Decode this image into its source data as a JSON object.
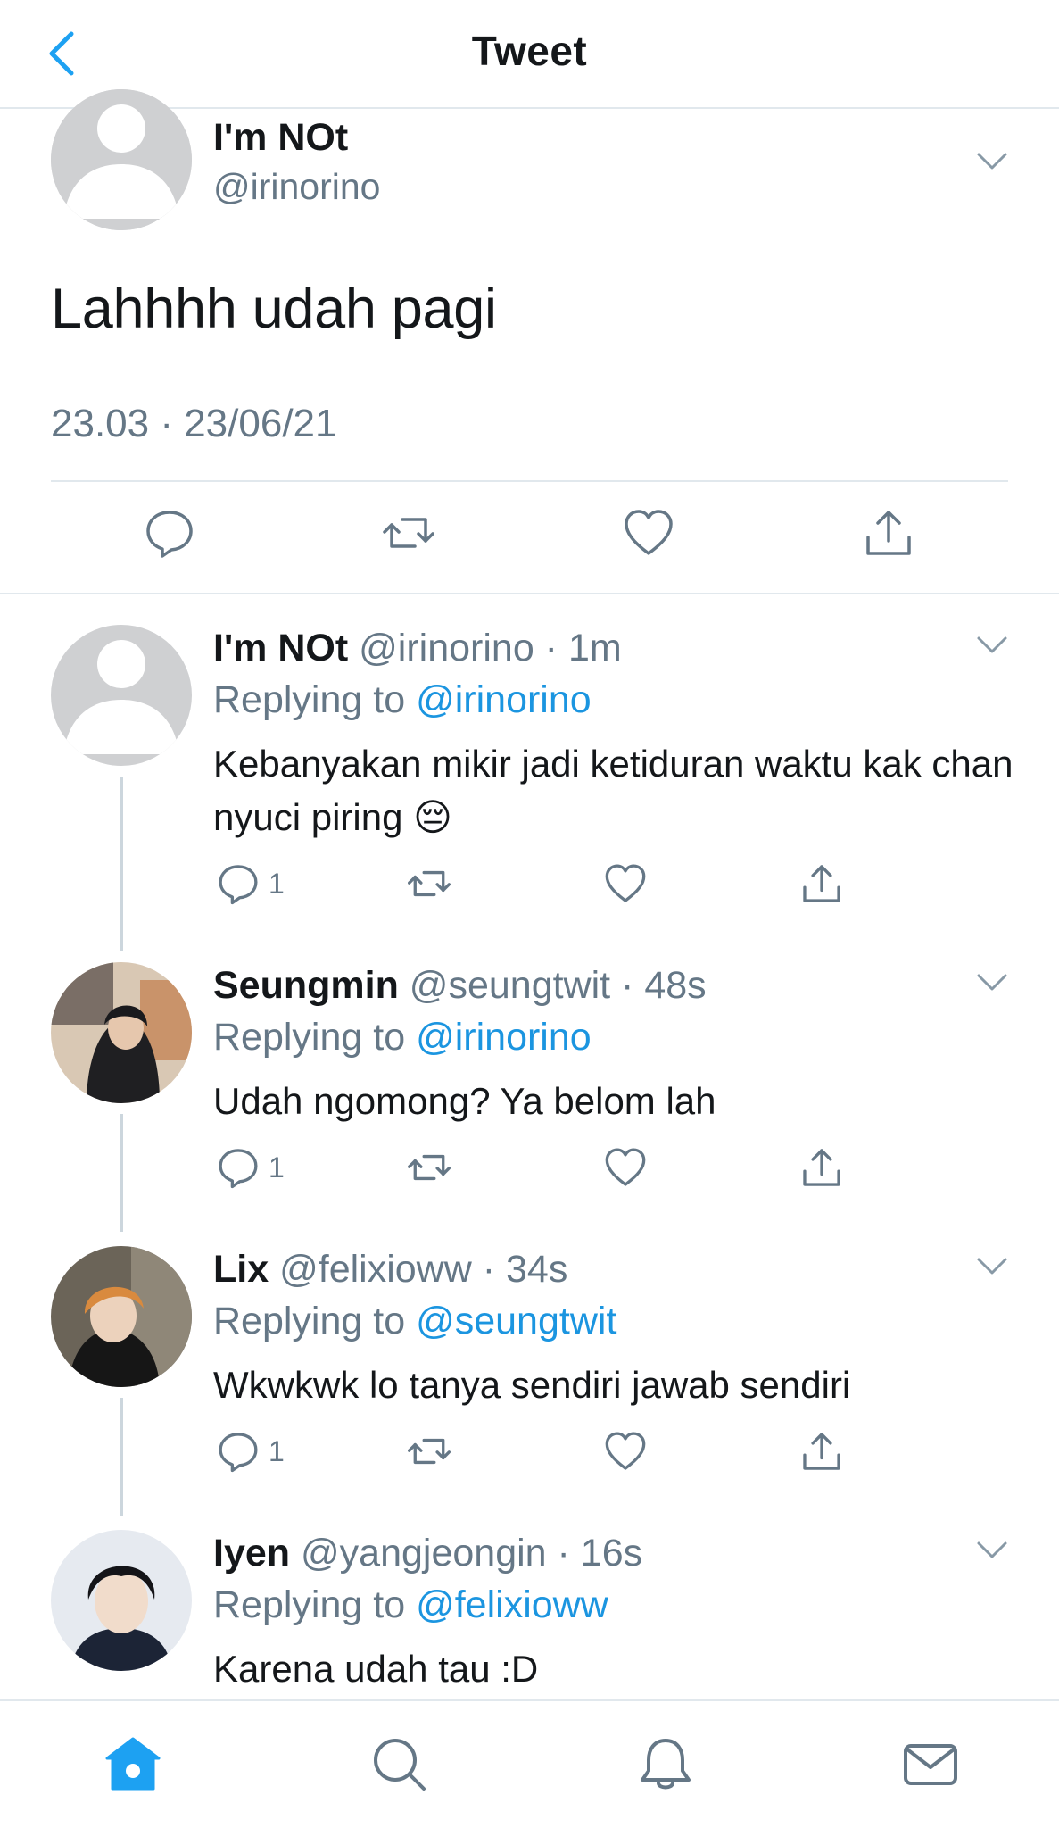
{
  "header": {
    "title": "Tweet",
    "back_icon": "chevron-left-icon"
  },
  "colors": {
    "accent": "#1da1f2",
    "mention": "#1b95e0",
    "secondary_text": "#657786",
    "divider": "#e1e8ed"
  },
  "main_tweet": {
    "name": "I'm NOt",
    "handle": "@irinorino",
    "text": "Lahhhh udah pagi",
    "timestamp": "23.03 · 23/06/21",
    "actions": [
      "reply-icon",
      "retweet-icon",
      "like-icon",
      "share-icon"
    ]
  },
  "replies": [
    {
      "name": "I'm NOt",
      "handle_time": "@irinorino · 1m",
      "replying_label": "Replying to ",
      "replying_to": "@irinorino",
      "text": "Kebanyakan mikir jadi ketiduran waktu kak chan nyuci piring 😔",
      "reply_count": "1",
      "avatar": "default-avatar"
    },
    {
      "name": "Seungmin",
      "handle_time": "@seungtwit · 48s",
      "replying_label": "Replying to ",
      "replying_to": "@irinorino",
      "text": "Udah ngomong? Ya belom lah",
      "reply_count": "1",
      "avatar": "photo-avatar"
    },
    {
      "name": "Lix",
      "handle_time": "@felixioww · 34s",
      "replying_label": "Replying to ",
      "replying_to": "@seungtwit",
      "text": "Wkwkwk lo tanya sendiri jawab sendiri",
      "reply_count": "1",
      "avatar": "photo-avatar"
    },
    {
      "name": "Iyen",
      "handle_time": "@yangjeongin · 16s",
      "replying_label": "Replying to ",
      "replying_to": "@felixioww",
      "text": "Karena udah tau :D",
      "avatar": "photo-avatar"
    }
  ],
  "tabbar": [
    "home-icon",
    "search-icon",
    "notifications-icon",
    "messages-icon"
  ]
}
